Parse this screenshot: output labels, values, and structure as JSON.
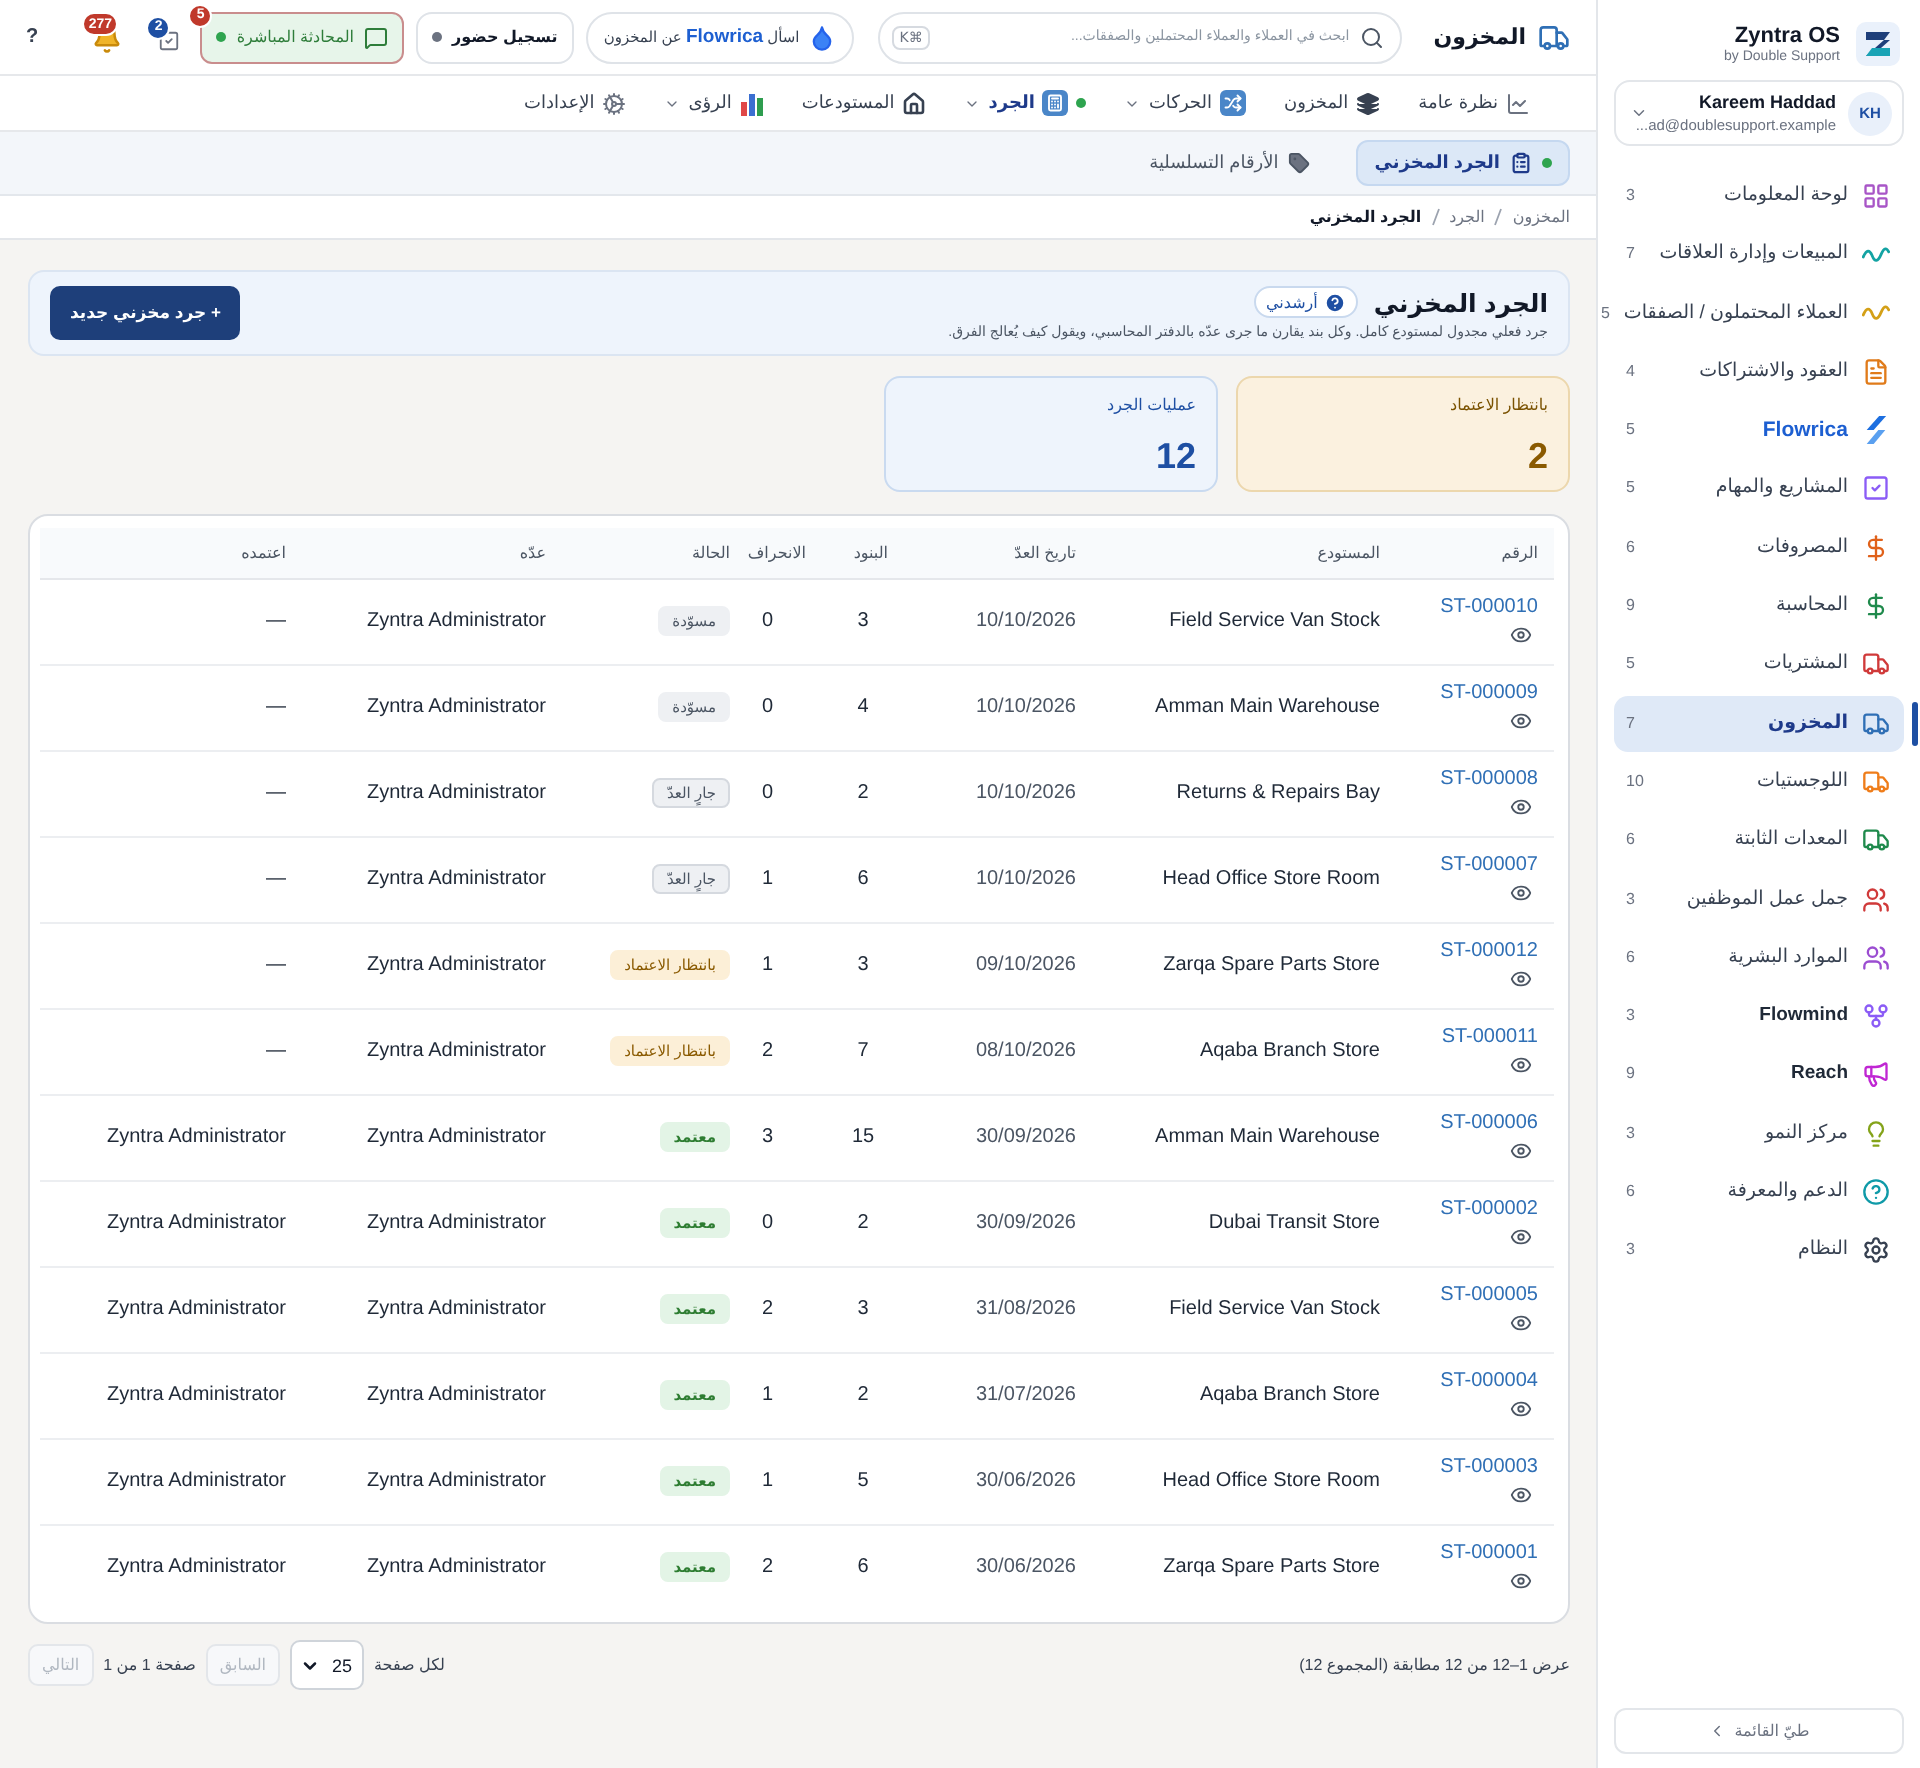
{
  "sidebar": {
    "brand": {
      "name": "Zyntra OS",
      "tagline": "by Double Support"
    },
    "user": {
      "initials": "KH",
      "name": "Kareem Haddad",
      "email": "...ad@doublesupport.example"
    },
    "items": [
      {
        "kind": "module",
        "label": "لوحة المعلومات",
        "count": "3",
        "selected": false
      },
      {
        "kind": "module",
        "label": "المبيعات وإدارة العلاقات",
        "count": "7",
        "selected": false
      },
      {
        "kind": "module",
        "label": "العملاء المحتملون / الصفقات",
        "count": "5",
        "selected": false
      },
      {
        "kind": "module",
        "label": "العقود والاشتراكات",
        "count": "4",
        "selected": false
      },
      {
        "kind": "product",
        "label": "Flowrica",
        "count": "5",
        "selected": false
      },
      {
        "kind": "module",
        "label": "المشاريع والمهام",
        "count": "5",
        "selected": false
      },
      {
        "kind": "module",
        "label": "المصروفات",
        "count": "6",
        "selected": false
      },
      {
        "kind": "module",
        "label": "المحاسبة",
        "count": "9",
        "selected": false
      },
      {
        "kind": "module",
        "label": "المشتريات",
        "count": "5",
        "selected": false
      },
      {
        "kind": "module",
        "label": "المخزون",
        "count": "7",
        "selected": true
      },
      {
        "kind": "module",
        "label": "اللوجستيات",
        "count": "10",
        "selected": false
      },
      {
        "kind": "module",
        "label": "المعدات الثابتة",
        "count": "6",
        "selected": false
      },
      {
        "kind": "module",
        "label": "جمل عمل الموظفين",
        "count": "3",
        "selected": false
      },
      {
        "kind": "module",
        "label": "الموارد البشرية",
        "count": "6",
        "selected": false
      },
      {
        "kind": "app",
        "label": "Flowmind",
        "count": "3",
        "selected": false
      },
      {
        "kind": "app",
        "label": "Reach",
        "count": "9",
        "selected": false
      },
      {
        "kind": "module",
        "label": "مركز النمو",
        "count": "3",
        "selected": false
      },
      {
        "kind": "module",
        "label": "الدعم والمعرفة",
        "count": "6",
        "selected": false
      },
      {
        "kind": "module",
        "label": "النظام",
        "count": "3",
        "selected": false
      }
    ],
    "collapse_button": "طيّ القائمة"
  },
  "topbar": {
    "title": "المخزون",
    "search": {
      "placeholder": "ابحث في العملاء والعملاء المحتملين والصفقات...",
      "shortcut": "⌘K"
    },
    "ask_button": "اسأل **Flowrica** عن المخزون",
    "check_in_button": "تسجيل حضور",
    "live_chat": {
      "label": "المحادثة المباشرة",
      "badge": "5"
    },
    "tasks_badge": "2",
    "notifications_badge": "277",
    "help_button": "?"
  },
  "nav": {
    "tabs": [
      {
        "label": "نظرة عامة",
        "selected": false,
        "has_menu": false
      },
      {
        "label": "المخزون",
        "selected": false,
        "has_menu": false
      },
      {
        "label": "الحركات",
        "selected": false,
        "has_menu": true
      },
      {
        "label": "الجرد",
        "selected": true,
        "has_menu": true
      },
      {
        "label": "المستودعات",
        "selected": false,
        "has_menu": false
      },
      {
        "label": "الرؤى",
        "selected": false,
        "has_menu": true
      },
      {
        "label": "الإعدادات",
        "selected": false,
        "has_menu": false
      }
    ]
  },
  "subtabs": [
    {
      "label": "الجرد المخزني",
      "selected": true
    },
    {
      "label": "الأرقام التسلسلية",
      "selected": false
    }
  ],
  "breadcrumb": [
    "المخزون",
    "الجرد",
    "الجرد المخزني"
  ],
  "page_header": {
    "title": "الجرد المخزني",
    "guide_button": "أرشدني",
    "description": "جرد فعلي مجدول لمستودع كامل. وكل بند يقارن ما جرى عدّه بالدفتر المحاسبي، ويقول كيف يُعالج الفرق.",
    "new_button": "+ جرد مخزني جديد"
  },
  "stats": [
    {
      "kind": "pending",
      "label": "بانتظار الاعتماد",
      "value": "2"
    },
    {
      "kind": "total",
      "label": "عمليات الجرد",
      "value": "12"
    }
  ],
  "table": {
    "columns": [
      "الرقم",
      "المستودع",
      "تاريخ العدّ",
      "البنود",
      "الانحراف",
      "الحالة",
      "عدّه",
      "اعتمده"
    ],
    "rows": [
      {
        "number": "ST-000010",
        "warehouse": "Field Service Van Stock",
        "date": "10/10/2026",
        "items": "3",
        "variance": "0",
        "status": {
          "kind": "draft",
          "label": "مسوّدة"
        },
        "counted_by": "Zyntra Administrator",
        "approved_by": "—"
      },
      {
        "number": "ST-000009",
        "warehouse": "Amman Main Warehouse",
        "date": "10/10/2026",
        "items": "4",
        "variance": "0",
        "status": {
          "kind": "draft",
          "label": "مسوّدة"
        },
        "counted_by": "Zyntra Administrator",
        "approved_by": "—"
      },
      {
        "number": "ST-000008",
        "warehouse": "Returns & Repairs Bay",
        "date": "10/10/2026",
        "items": "2",
        "variance": "0",
        "status": {
          "kind": "counting",
          "label": "جارٍ العدّ"
        },
        "counted_by": "Zyntra Administrator",
        "approved_by": "—"
      },
      {
        "number": "ST-000007",
        "warehouse": "Head Office Store Room",
        "date": "10/10/2026",
        "items": "6",
        "variance": "1",
        "status": {
          "kind": "counting",
          "label": "جارٍ العدّ"
        },
        "counted_by": "Zyntra Administrator",
        "approved_by": "—"
      },
      {
        "number": "ST-000012",
        "warehouse": "Zarqa Spare Parts Store",
        "date": "09/10/2026",
        "items": "3",
        "variance": "1",
        "status": {
          "kind": "pending",
          "label": "بانتظار الاعتماد"
        },
        "counted_by": "Zyntra Administrator",
        "approved_by": "—"
      },
      {
        "number": "ST-000011",
        "warehouse": "Aqaba Branch Store",
        "date": "08/10/2026",
        "items": "7",
        "variance": "2",
        "status": {
          "kind": "pending",
          "label": "بانتظار الاعتماد"
        },
        "counted_by": "Zyntra Administrator",
        "approved_by": "—"
      },
      {
        "number": "ST-000006",
        "warehouse": "Amman Main Warehouse",
        "date": "30/09/2026",
        "items": "15",
        "variance": "3",
        "status": {
          "kind": "approved",
          "label": "معتمد"
        },
        "counted_by": "Zyntra Administrator",
        "approved_by": "Zyntra Administrator"
      },
      {
        "number": "ST-000002",
        "warehouse": "Dubai Transit Store",
        "date": "30/09/2026",
        "items": "2",
        "variance": "0",
        "status": {
          "kind": "approved",
          "label": "معتمد"
        },
        "counted_by": "Zyntra Administrator",
        "approved_by": "Zyntra Administrator"
      },
      {
        "number": "ST-000005",
        "warehouse": "Field Service Van Stock",
        "date": "31/08/2026",
        "items": "3",
        "variance": "2",
        "status": {
          "kind": "approved",
          "label": "معتمد"
        },
        "counted_by": "Zyntra Administrator",
        "approved_by": "Zyntra Administrator"
      },
      {
        "number": "ST-000004",
        "warehouse": "Aqaba Branch Store",
        "date": "31/07/2026",
        "items": "2",
        "variance": "1",
        "status": {
          "kind": "approved",
          "label": "معتمد"
        },
        "counted_by": "Zyntra Administrator",
        "approved_by": "Zyntra Administrator"
      },
      {
        "number": "ST-000003",
        "warehouse": "Head Office Store Room",
        "date": "30/06/2026",
        "items": "5",
        "variance": "1",
        "status": {
          "kind": "approved",
          "label": "معتمد"
        },
        "counted_by": "Zyntra Administrator",
        "approved_by": "Zyntra Administrator"
      },
      {
        "number": "ST-000001",
        "warehouse": "Zarqa Spare Parts Store",
        "date": "30/06/2026",
        "items": "6",
        "variance": "2",
        "status": {
          "kind": "approved",
          "label": "معتمد"
        },
        "counted_by": "Zyntra Administrator",
        "approved_by": "Zyntra Administrator"
      }
    ]
  },
  "pagination": {
    "summary": "عرض 1–12 من 12 مطابقة (المجموع 12)",
    "per_page_label": "لكل صفحة",
    "per_page": "25",
    "previous": {
      "label": "السابق",
      "disabled": true
    },
    "page_info": "صفحة 1 من 1",
    "next": {
      "label": "التالي",
      "disabled": true
    }
  }
}
